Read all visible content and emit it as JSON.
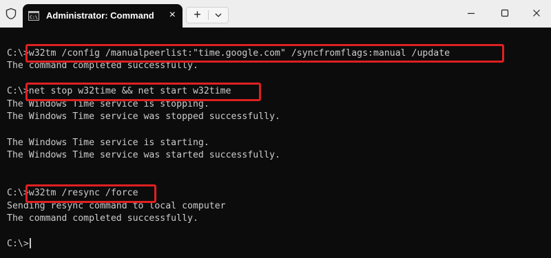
{
  "window": {
    "tab_title": "Administrator: Command Pro",
    "new_tab": "+",
    "dropdown": "⌄",
    "close_tab": "×",
    "minimize": "−",
    "maximize": "☐",
    "close": "✕"
  },
  "terminal": {
    "lines": [
      "C:\\>w32tm /config /manualpeerlist:\"time.google.com\" /syncfromflags:manual /update",
      "The command completed successfully.",
      "C:\\>net stop w32time && net start w32time",
      "The Windows Time service is stopping.",
      "The Windows Time service was stopped successfully.",
      "The Windows Time service is starting.",
      "The Windows Time service was started successfully.",
      "C:\\>w32tm /resync /force",
      "Sending resync command to local computer",
      "The command completed successfully.",
      "C:\\>"
    ]
  },
  "colors": {
    "terminal_bg": "#0c0c0c",
    "terminal_text": "#cccccc",
    "highlight": "#e02020",
    "titlebar_bg": "#eeeeee"
  },
  "icons": [
    "shield-icon",
    "cmd-icon",
    "close-icon",
    "plus-icon",
    "chevron-down-icon",
    "minimize-icon",
    "maximize-icon",
    "window-close-icon"
  ]
}
